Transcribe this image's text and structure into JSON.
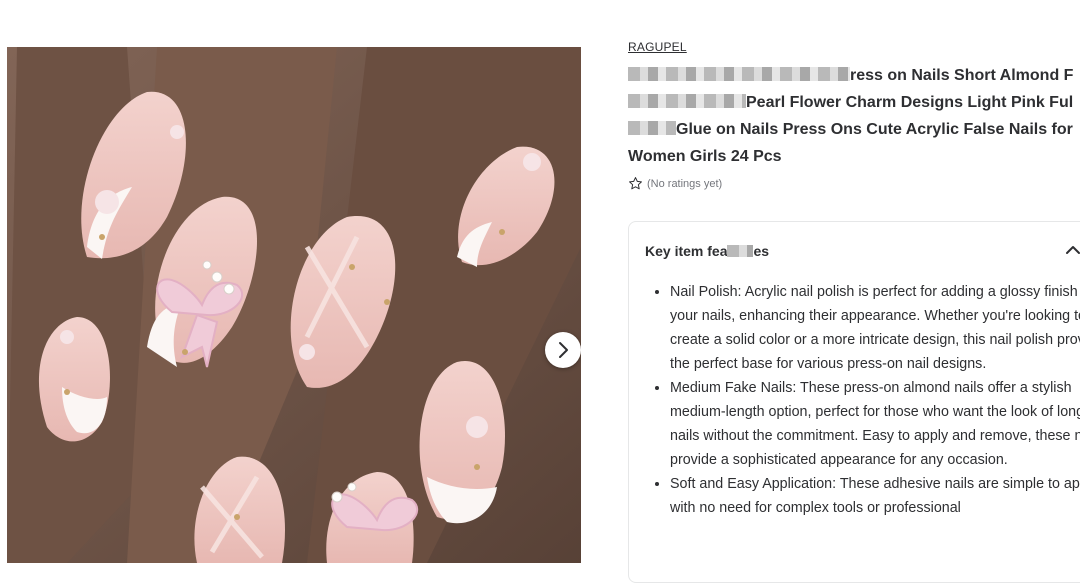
{
  "product": {
    "brand": "RAGUPEL",
    "title_lines": [
      "ress on Nails Short Almond F",
      "Pearl Flower Charm Designs Light Pink Ful",
      "Glue on Nails Press Ons Cute Acrylic False Nails for",
      "Women Girls 24 Pcs"
    ],
    "rating_text": "(No ratings yet)"
  },
  "features": {
    "heading_prefix": "Key item fea",
    "heading_suffix": "es",
    "items": [
      "Nail Polish: Acrylic nail polish is perfect for adding a glossy finish to your nails, enhancing their appearance. Whether you're looking to create a solid color or a more intricate design, this nail polish provides the perfect base for various press-on nail designs.",
      "Medium Fake Nails: These press-on almond nails offer a stylish medium-length option, perfect for those who want the look of longer nails without the commitment. Easy to apply and remove, these nails provide a sophisticated appearance for any occasion.",
      "Soft and Easy Application: These adhesive nails are simple to apply, with no need for complex tools or professional"
    ]
  },
  "colors": {
    "text": "#2e2f32",
    "muted": "#74767c",
    "star_outline": "#2e2f32",
    "border": "#e6e7e8"
  },
  "icons": {
    "next": "chevron-right-icon",
    "star": "star-outline-icon",
    "collapse": "chevron-up-icon"
  }
}
